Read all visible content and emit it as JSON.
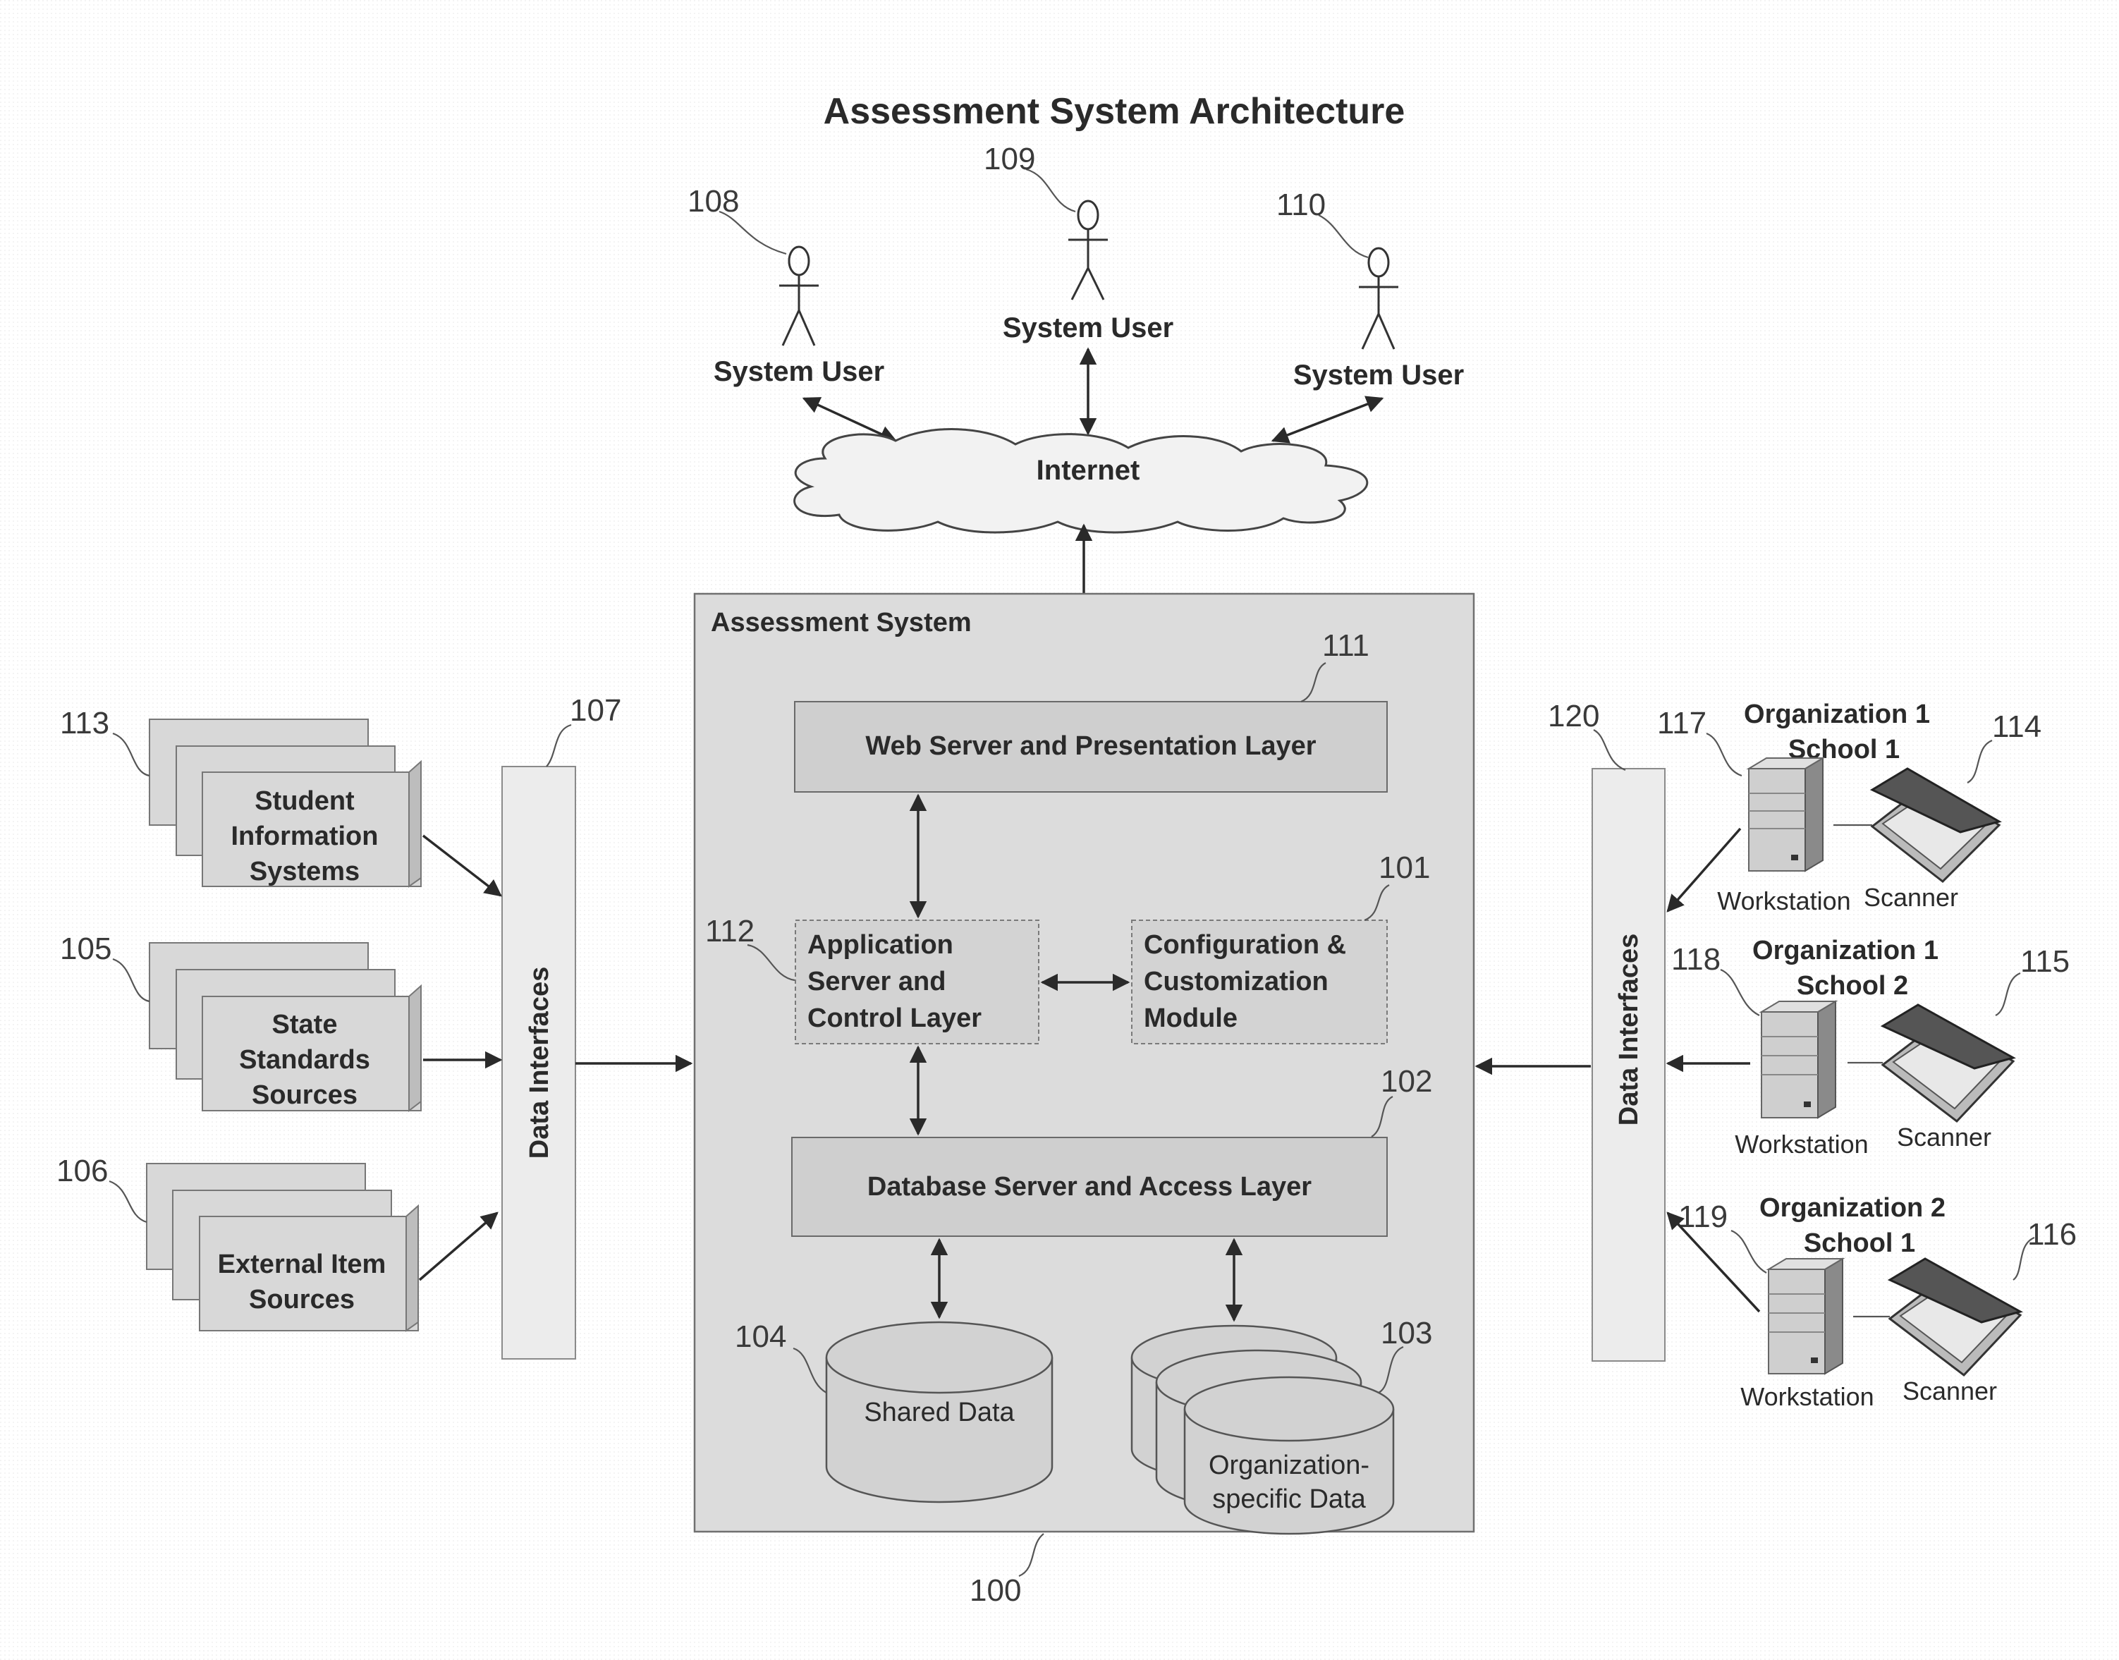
{
  "title": "Assessment System Architecture",
  "users": [
    {
      "ref": "108",
      "label": "System User"
    },
    {
      "ref": "109",
      "label": "System User"
    },
    {
      "ref": "110",
      "label": "System User"
    }
  ],
  "internet": {
    "label": "Internet"
  },
  "assessment_system": {
    "ref": "100",
    "label": "Assessment System",
    "web_layer": {
      "ref": "111",
      "label": "Web Server and Presentation Layer"
    },
    "app_layer": {
      "ref": "112",
      "lines": [
        "Application",
        "Server and",
        "Control Layer"
      ]
    },
    "config_module": {
      "ref": "101",
      "lines": [
        "Configuration &",
        "Customization",
        "Module"
      ]
    },
    "db_layer": {
      "ref": "102",
      "label": "Database Server and Access Layer"
    },
    "shared_data": {
      "ref": "104",
      "label": "Shared Data"
    },
    "org_data": {
      "ref": "103",
      "lines": [
        "Organization-",
        "specific Data"
      ]
    }
  },
  "left_interfaces": {
    "ref": "107",
    "label": "Data Interfaces"
  },
  "right_interfaces": {
    "ref": "120",
    "label": "Data Interfaces"
  },
  "sources": [
    {
      "ref": "113",
      "lines": [
        "Student",
        "Information",
        "Systems"
      ]
    },
    {
      "ref": "105",
      "lines": [
        "State",
        "Standards",
        "Sources"
      ]
    },
    {
      "ref": "106",
      "lines": [
        "External Item",
        "Sources"
      ]
    }
  ],
  "sites": [
    {
      "org_lines": [
        "Organization 1",
        "School 1"
      ],
      "workstation_ref": "117",
      "scanner_ref": "114",
      "workstation_label": "Workstation",
      "scanner_label": "Scanner"
    },
    {
      "org_lines": [
        "Organization 1",
        "School 2"
      ],
      "workstation_ref": "118",
      "scanner_ref": "115",
      "workstation_label": "Workstation",
      "scanner_label": "Scanner"
    },
    {
      "org_lines": [
        "Organization 2",
        "School 1"
      ],
      "workstation_ref": "119",
      "scanner_ref": "116",
      "workstation_label": "Workstation",
      "scanner_label": "Scanner"
    }
  ]
}
